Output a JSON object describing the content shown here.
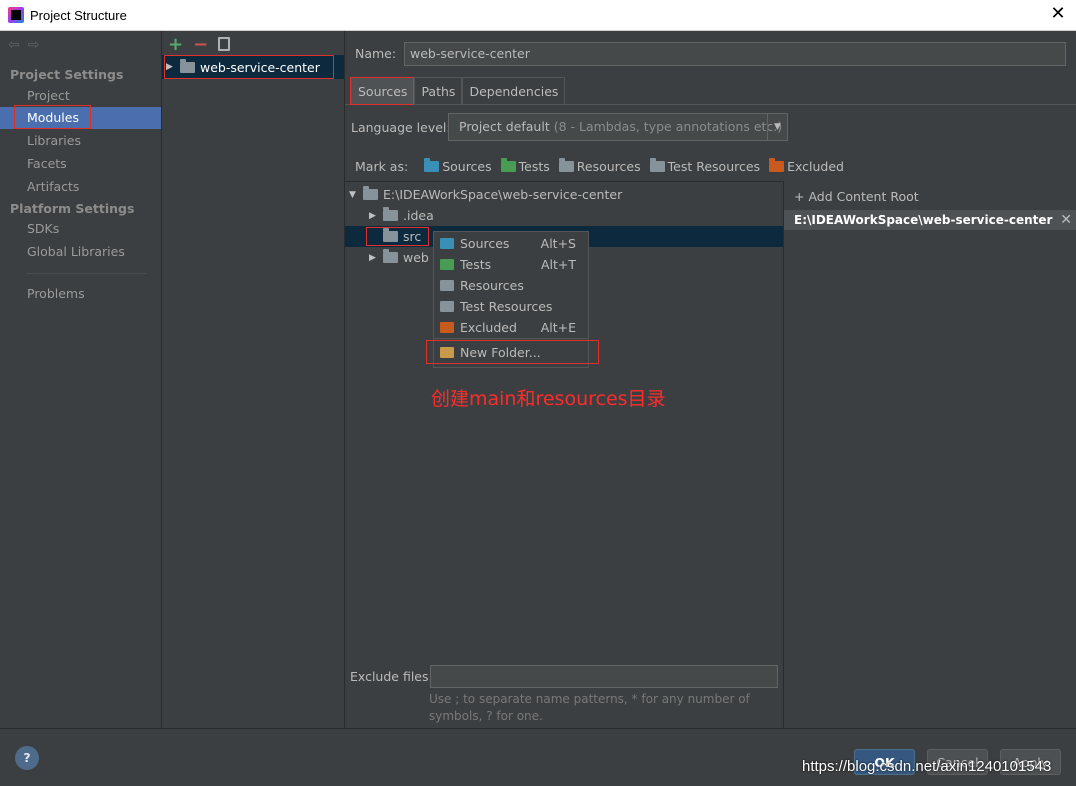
{
  "window": {
    "title": "Project Structure"
  },
  "leftnav": {
    "sections": [
      "Project Settings",
      "Platform Settings"
    ],
    "project_items": [
      "Project",
      "Modules",
      "Libraries",
      "Facets",
      "Artifacts"
    ],
    "platform_items": [
      "SDKs",
      "Global Libraries"
    ],
    "problems": "Problems",
    "selected": "Modules"
  },
  "modules": {
    "items": [
      "web-service-center"
    ]
  },
  "main": {
    "name_label": "Name:",
    "name_value": "web-service-center",
    "tabs": [
      "Sources",
      "Paths",
      "Dependencies"
    ],
    "active_tab": "Sources",
    "language_label": "Language level:",
    "language_value": "Project default",
    "language_detail": "(8 - Lambdas, type annotations etc.)",
    "mark_as_label": "Mark as:",
    "mark_as": [
      {
        "label": "Sources",
        "color": "#3a8fb7"
      },
      {
        "label": "Tests",
        "color": "#499c54"
      },
      {
        "label": "Resources",
        "color": "#87939a"
      },
      {
        "label": "Test Resources",
        "color": "#87939a"
      },
      {
        "label": "Excluded",
        "color": "#c85a1f"
      }
    ],
    "tree": {
      "root": "E:\\IDEAWorkSpace\\web-service-center",
      "children": [
        ".idea",
        "src",
        "web"
      ]
    },
    "add_content_root": "Add Content Root",
    "content_root_path": "E:\\IDEAWorkSpace\\web-service-center",
    "exclude_label": "Exclude files:",
    "exclude_value": "",
    "exclude_hint": "Use ; to separate name patterns, * for any number of symbols, ? for one."
  },
  "context_menu": {
    "items": [
      {
        "label": "Sources",
        "shortcut": "Alt+S",
        "color": "#3a8fb7"
      },
      {
        "label": "Tests",
        "shortcut": "Alt+T",
        "color": "#499c54"
      },
      {
        "label": "Resources",
        "shortcut": "",
        "color": "#87939a"
      },
      {
        "label": "Test Resources",
        "shortcut": "",
        "color": "#87939a"
      },
      {
        "label": "Excluded",
        "shortcut": "Alt+E",
        "color": "#c85a1f"
      }
    ],
    "new_folder": "New Folder..."
  },
  "annotation": "创建main和resources目录",
  "buttons": {
    "ok": "OK",
    "cancel": "Cancel",
    "apply": "Apply",
    "help": "?"
  },
  "watermark": "https://blog.csdn.net/axin1240101543"
}
